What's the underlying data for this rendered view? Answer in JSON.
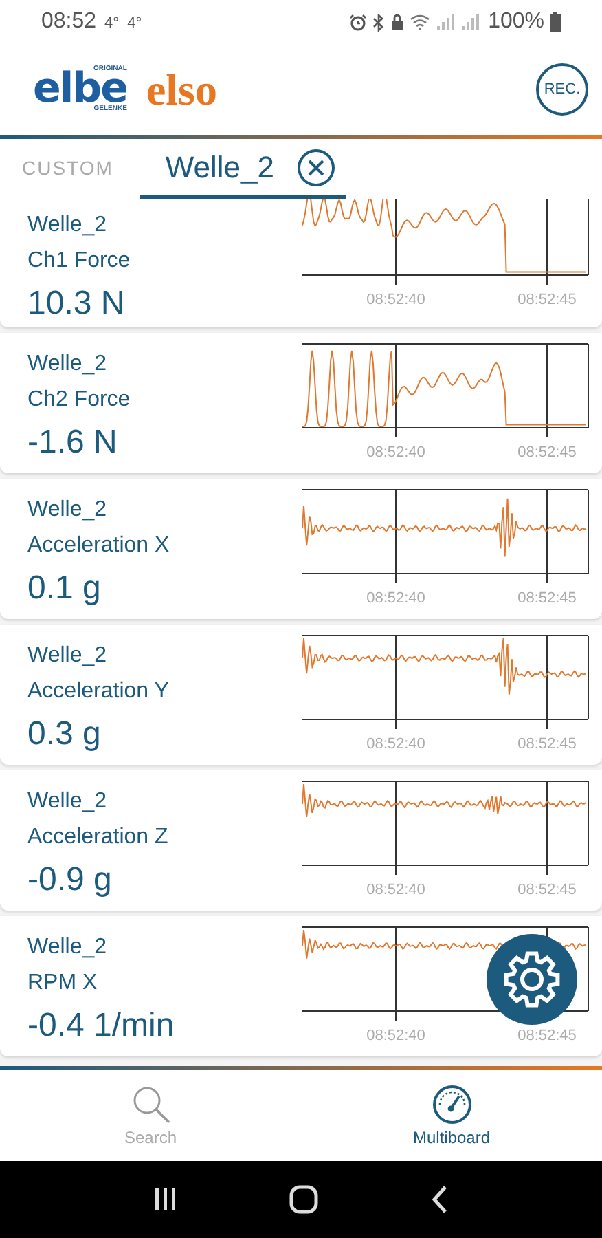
{
  "status_bar": {
    "time": "08:52",
    "indicators": [
      "4°",
      "4°"
    ],
    "battery": "100%"
  },
  "header": {
    "logo_elbe": {
      "text": "elbe",
      "top": "ORIGINAL",
      "bottom": "GELENKE"
    },
    "logo_elso": "elso",
    "rec_button": "REC."
  },
  "tabs": [
    {
      "label": "CUSTOM",
      "selected": false,
      "closable": false
    },
    {
      "label": "Welle_2",
      "selected": true,
      "closable": true
    }
  ],
  "channels": [
    {
      "device": "Welle_2",
      "name": "Ch1 Force",
      "value": "10.3 N",
      "kind": "force",
      "time_labels": [
        "08:52:40",
        "08:52:45"
      ]
    },
    {
      "device": "Welle_2",
      "name": "Ch2 Force",
      "value": "-1.6 N",
      "kind": "force",
      "time_labels": [
        "08:52:40",
        "08:52:45"
      ]
    },
    {
      "device": "Welle_2",
      "name": "Acceleration X",
      "value": "0.1 g",
      "kind": "vibration",
      "time_labels": [
        "08:52:40",
        "08:52:45"
      ]
    },
    {
      "device": "Welle_2",
      "name": "Acceleration Y",
      "value": "0.3 g",
      "kind": "vibration",
      "time_labels": [
        "08:52:40",
        "08:52:45"
      ]
    },
    {
      "device": "Welle_2",
      "name": "Acceleration Z",
      "value": "-0.9 g",
      "kind": "vibration",
      "time_labels": [
        "08:52:40",
        "08:52:45"
      ]
    },
    {
      "device": "Welle_2",
      "name": "RPM X",
      "value": "-0.4 1/min",
      "kind": "vibration",
      "time_labels": [
        "08:52:40",
        "08:52:45"
      ]
    }
  ],
  "bottom_nav": [
    {
      "label": "Search",
      "kind": "search",
      "selected": false
    },
    {
      "label": "Multiboard",
      "kind": "dashboard",
      "selected": true
    }
  ]
}
